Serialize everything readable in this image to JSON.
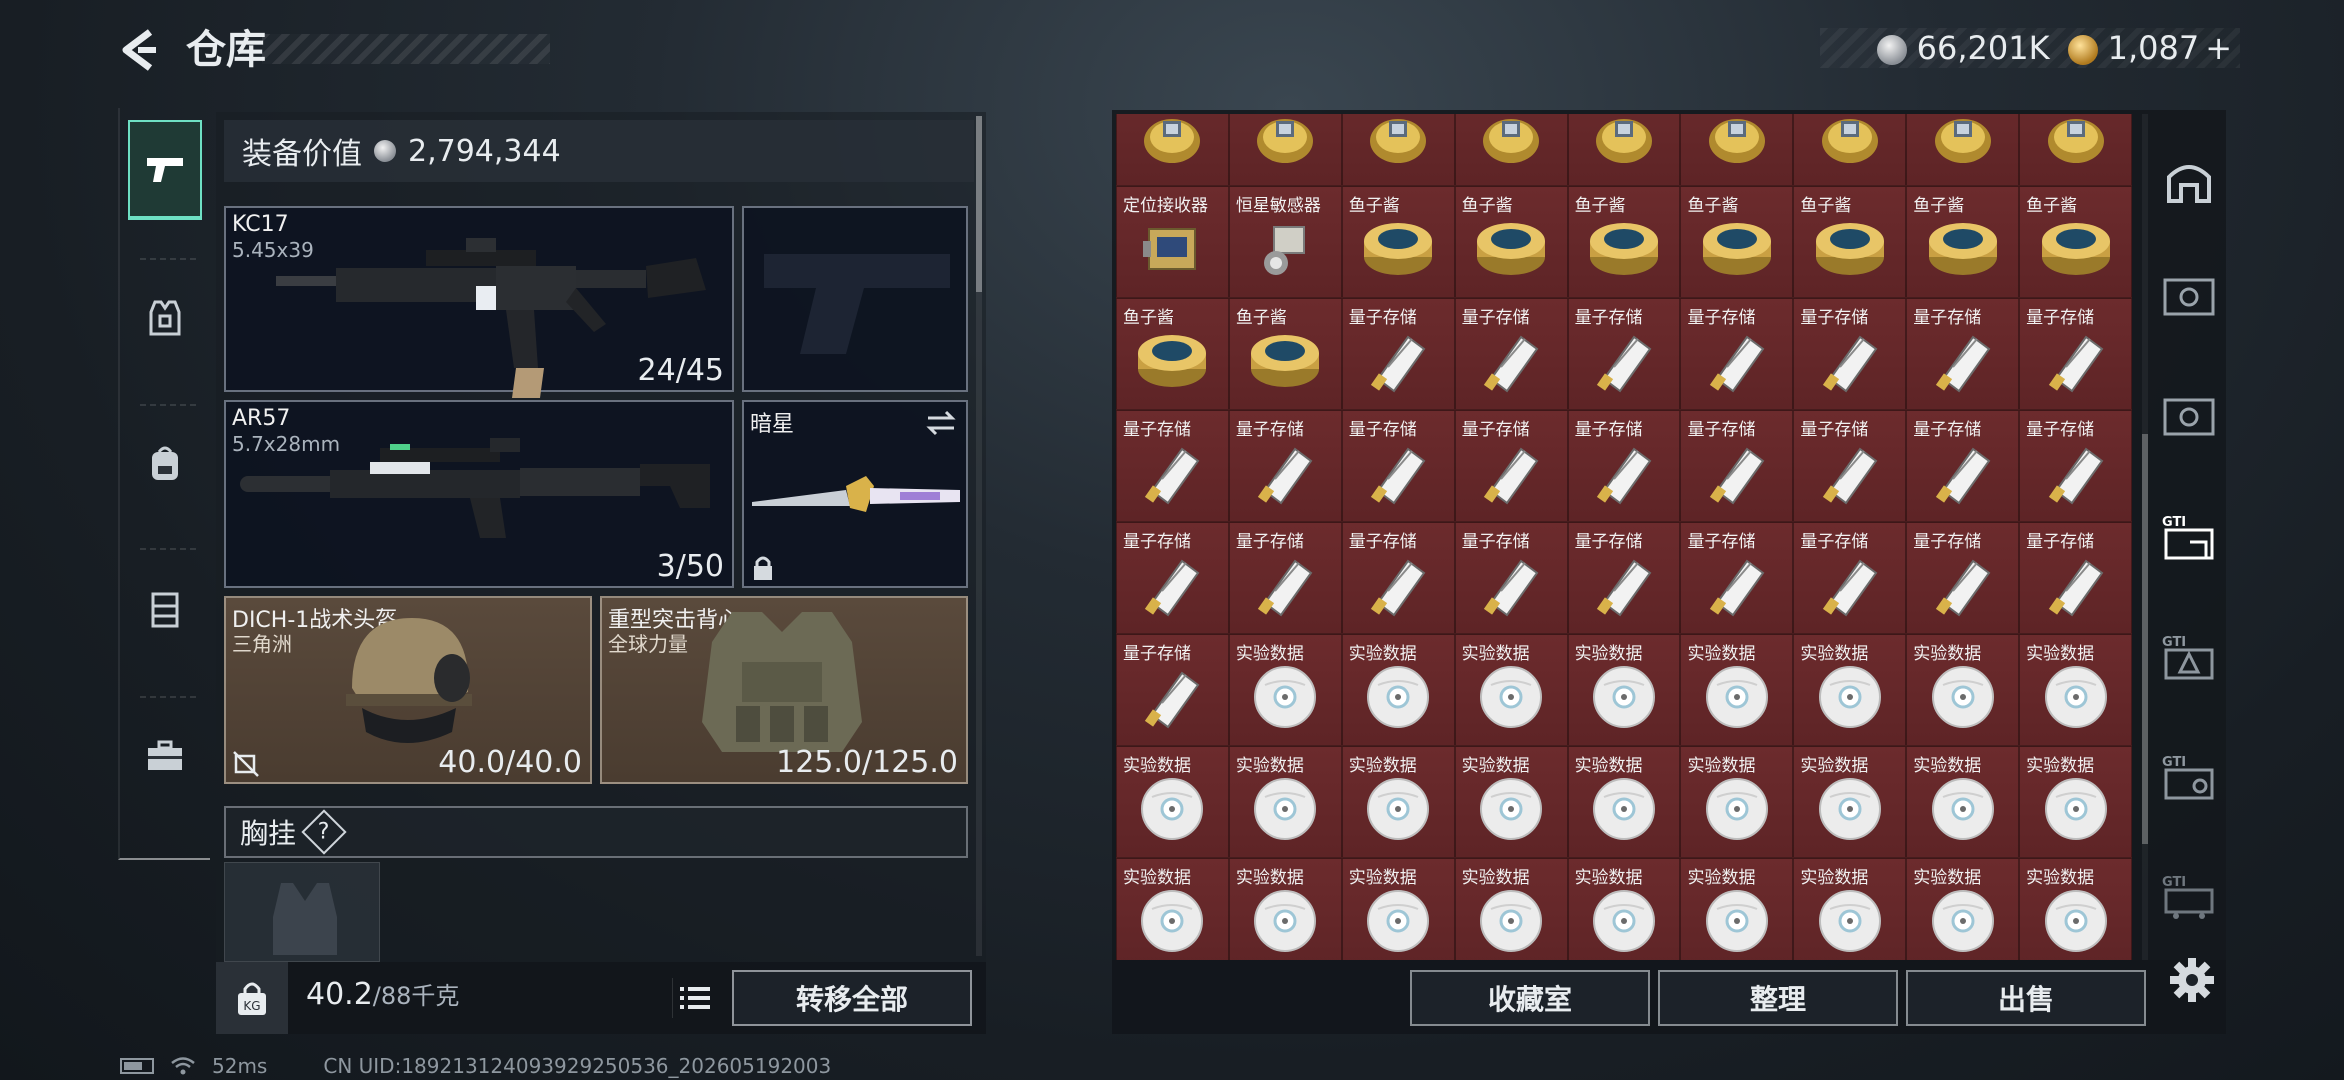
{
  "header": {
    "title": "仓库",
    "back_icon": "back-arrow-icon"
  },
  "currency": [
    {
      "icon": "silver-coin-icon",
      "value": "66,201K"
    },
    {
      "icon": "gold-coin-icon",
      "value": "1,087",
      "suffix": "+"
    }
  ],
  "left_rail": {
    "tabs": [
      {
        "icon": "pistol-icon",
        "active": true
      },
      {
        "icon": "armor-rig-icon",
        "active": false
      },
      {
        "icon": "backpack-icon",
        "active": false
      },
      {
        "icon": "vest-icon",
        "active": false
      },
      {
        "icon": "toolbox-icon",
        "active": false
      }
    ]
  },
  "loadout": {
    "equip_value_label": "装备价值",
    "equip_value": "2,794,344",
    "primary": {
      "name": "KC17",
      "ammo": "5.45x39",
      "count": "24/45"
    },
    "secondary": {
      "name": "AR57",
      "ammo": "5.7x28mm",
      "count": "3/50"
    },
    "melee": {
      "name": "暗星"
    },
    "helmet": {
      "name": "DICH-1战术头盔",
      "brand": "三角洲",
      "durability": "40.0/40.0"
    },
    "armor": {
      "name": "重型突击背心",
      "brand": "全球力量",
      "durability": "125.0/125.0"
    },
    "chest_rig_label": "胸挂",
    "chest_rig_help": "?"
  },
  "bottom_left": {
    "weight": "40.2",
    "weight_max": "/88千克",
    "transfer_all": "转移全部"
  },
  "grid": {
    "rows": [
      [
        {
          "label": "",
          "icon": "ring"
        },
        {
          "label": "",
          "icon": "ring"
        },
        {
          "label": "",
          "icon": "ring"
        },
        {
          "label": "",
          "icon": "ring"
        },
        {
          "label": "",
          "icon": "ring"
        },
        {
          "label": "",
          "icon": "ring"
        },
        {
          "label": "",
          "icon": "ring"
        },
        {
          "label": "",
          "icon": "ring"
        },
        {
          "label": "",
          "icon": "ring"
        }
      ],
      [
        {
          "label": "定位接收器",
          "icon": "receiver"
        },
        {
          "label": "恒星敏感器",
          "icon": "sensor"
        },
        {
          "label": "鱼子酱",
          "icon": "caviar"
        },
        {
          "label": "鱼子酱",
          "icon": "caviar"
        },
        {
          "label": "鱼子酱",
          "icon": "caviar"
        },
        {
          "label": "鱼子酱",
          "icon": "caviar"
        },
        {
          "label": "鱼子酱",
          "icon": "caviar"
        },
        {
          "label": "鱼子酱",
          "icon": "caviar"
        },
        {
          "label": "鱼子酱",
          "icon": "caviar"
        }
      ],
      [
        {
          "label": "鱼子酱",
          "icon": "caviar"
        },
        {
          "label": "鱼子酱",
          "icon": "caviar"
        },
        {
          "label": "量子存储",
          "icon": "usb"
        },
        {
          "label": "量子存储",
          "icon": "usb"
        },
        {
          "label": "量子存储",
          "icon": "usb"
        },
        {
          "label": "量子存储",
          "icon": "usb"
        },
        {
          "label": "量子存储",
          "icon": "usb"
        },
        {
          "label": "量子存储",
          "icon": "usb"
        },
        {
          "label": "量子存储",
          "icon": "usb"
        }
      ],
      [
        {
          "label": "量子存储",
          "icon": "usb"
        },
        {
          "label": "量子存储",
          "icon": "usb"
        },
        {
          "label": "量子存储",
          "icon": "usb"
        },
        {
          "label": "量子存储",
          "icon": "usb"
        },
        {
          "label": "量子存储",
          "icon": "usb"
        },
        {
          "label": "量子存储",
          "icon": "usb"
        },
        {
          "label": "量子存储",
          "icon": "usb"
        },
        {
          "label": "量子存储",
          "icon": "usb"
        },
        {
          "label": "量子存储",
          "icon": "usb"
        }
      ],
      [
        {
          "label": "量子存储",
          "icon": "usb"
        },
        {
          "label": "量子存储",
          "icon": "usb"
        },
        {
          "label": "量子存储",
          "icon": "usb"
        },
        {
          "label": "量子存储",
          "icon": "usb"
        },
        {
          "label": "量子存储",
          "icon": "usb"
        },
        {
          "label": "量子存储",
          "icon": "usb"
        },
        {
          "label": "量子存储",
          "icon": "usb"
        },
        {
          "label": "量子存储",
          "icon": "usb"
        },
        {
          "label": "量子存储",
          "icon": "usb"
        }
      ],
      [
        {
          "label": "量子存储",
          "icon": "usb"
        },
        {
          "label": "实验数据",
          "icon": "disc"
        },
        {
          "label": "实验数据",
          "icon": "disc"
        },
        {
          "label": "实验数据",
          "icon": "disc"
        },
        {
          "label": "实验数据",
          "icon": "disc"
        },
        {
          "label": "实验数据",
          "icon": "disc"
        },
        {
          "label": "实验数据",
          "icon": "disc"
        },
        {
          "label": "实验数据",
          "icon": "disc"
        },
        {
          "label": "实验数据",
          "icon": "disc"
        }
      ],
      [
        {
          "label": "实验数据",
          "icon": "disc"
        },
        {
          "label": "实验数据",
          "icon": "disc"
        },
        {
          "label": "实验数据",
          "icon": "disc"
        },
        {
          "label": "实验数据",
          "icon": "disc"
        },
        {
          "label": "实验数据",
          "icon": "disc"
        },
        {
          "label": "实验数据",
          "icon": "disc"
        },
        {
          "label": "实验数据",
          "icon": "disc"
        },
        {
          "label": "实验数据",
          "icon": "disc"
        },
        {
          "label": "实验数据",
          "icon": "disc"
        }
      ],
      [
        {
          "label": "实验数据",
          "icon": "disc"
        },
        {
          "label": "实验数据",
          "icon": "disc"
        },
        {
          "label": "实验数据",
          "icon": "disc"
        },
        {
          "label": "实验数据",
          "icon": "disc"
        },
        {
          "label": "实验数据",
          "icon": "disc"
        },
        {
          "label": "实验数据",
          "icon": "disc"
        },
        {
          "label": "实验数据",
          "icon": "disc"
        },
        {
          "label": "实验数据",
          "icon": "disc"
        },
        {
          "label": "实验数据",
          "icon": "disc"
        }
      ]
    ]
  },
  "right_rail": {
    "tabs": [
      {
        "icon": "home-gate-icon"
      },
      {
        "icon": "vault-card-icon"
      },
      {
        "icon": "vault-card-icon"
      },
      {
        "icon": "gti-hand-icon",
        "active": true
      },
      {
        "icon": "gti-warning-icon"
      },
      {
        "icon": "gti-safe-icon"
      },
      {
        "icon": "gti-cart-icon"
      }
    ]
  },
  "bottom_right": {
    "collection": "收藏室",
    "sort": "整理",
    "sell": "出售"
  },
  "status": {
    "ping": "52ms",
    "uid": "CN UID:18921312409392925053​6_202605192003"
  }
}
